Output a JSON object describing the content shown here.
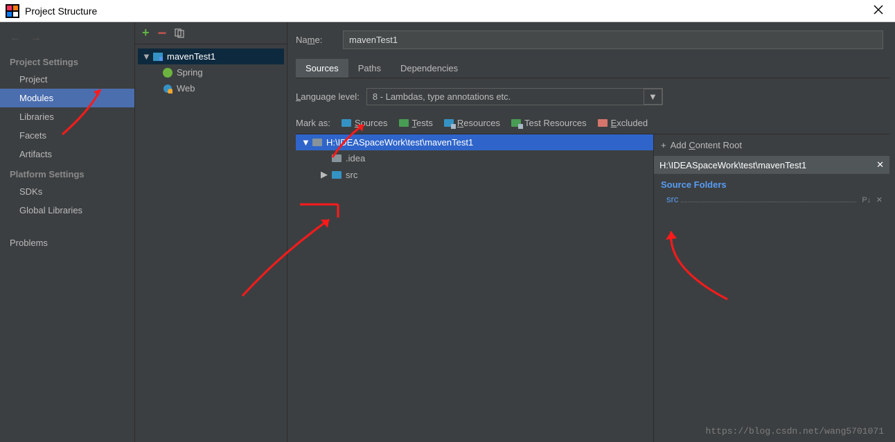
{
  "window": {
    "title": "Project Structure"
  },
  "sidebar": {
    "section_project": "Project Settings",
    "section_platform": "Platform Settings",
    "items": {
      "project": "Project",
      "modules": "Modules",
      "libraries": "Libraries",
      "facets": "Facets",
      "artifacts": "Artifacts",
      "sdks": "SDKs",
      "global_libraries": "Global Libraries",
      "problems": "Problems"
    }
  },
  "modtree": {
    "root": "mavenTest1",
    "children": {
      "spring": "Spring",
      "web": "Web"
    }
  },
  "content": {
    "name_label_pre": "Na",
    "name_label_ul": "m",
    "name_label_post": "e:",
    "name_value": "mavenTest1",
    "tabs": {
      "sources": "Sources",
      "paths": "Paths",
      "dependencies": "Dependencies"
    },
    "lang_label_ul": "L",
    "lang_label_post": "anguage level:",
    "lang_value": "8 - Lambdas, type annotations etc.",
    "mark_as": "Mark as:",
    "marks": {
      "sources_ul": "S",
      "sources_post": "ources",
      "tests_ul": "T",
      "tests_post": "ests",
      "resources_ul": "R",
      "resources_post": "esources",
      "testres_pre": "T",
      "testres_post": "est Resources",
      "excluded_ul": "E",
      "excluded_post": "xcluded"
    },
    "dir": {
      "root": "H:\\IDEASpaceWork\\test\\mavenTest1",
      "idea": ".idea",
      "src": "src"
    },
    "rightpanel": {
      "add_root_pre": "Add ",
      "add_root_ul": "C",
      "add_root_post": "ontent Root",
      "path": "H:\\IDEASpaceWork\\test\\mavenTest1",
      "source_folders": "Source Folders",
      "src": "src"
    },
    "watermark": "https://blog.csdn.net/wang5701071"
  }
}
